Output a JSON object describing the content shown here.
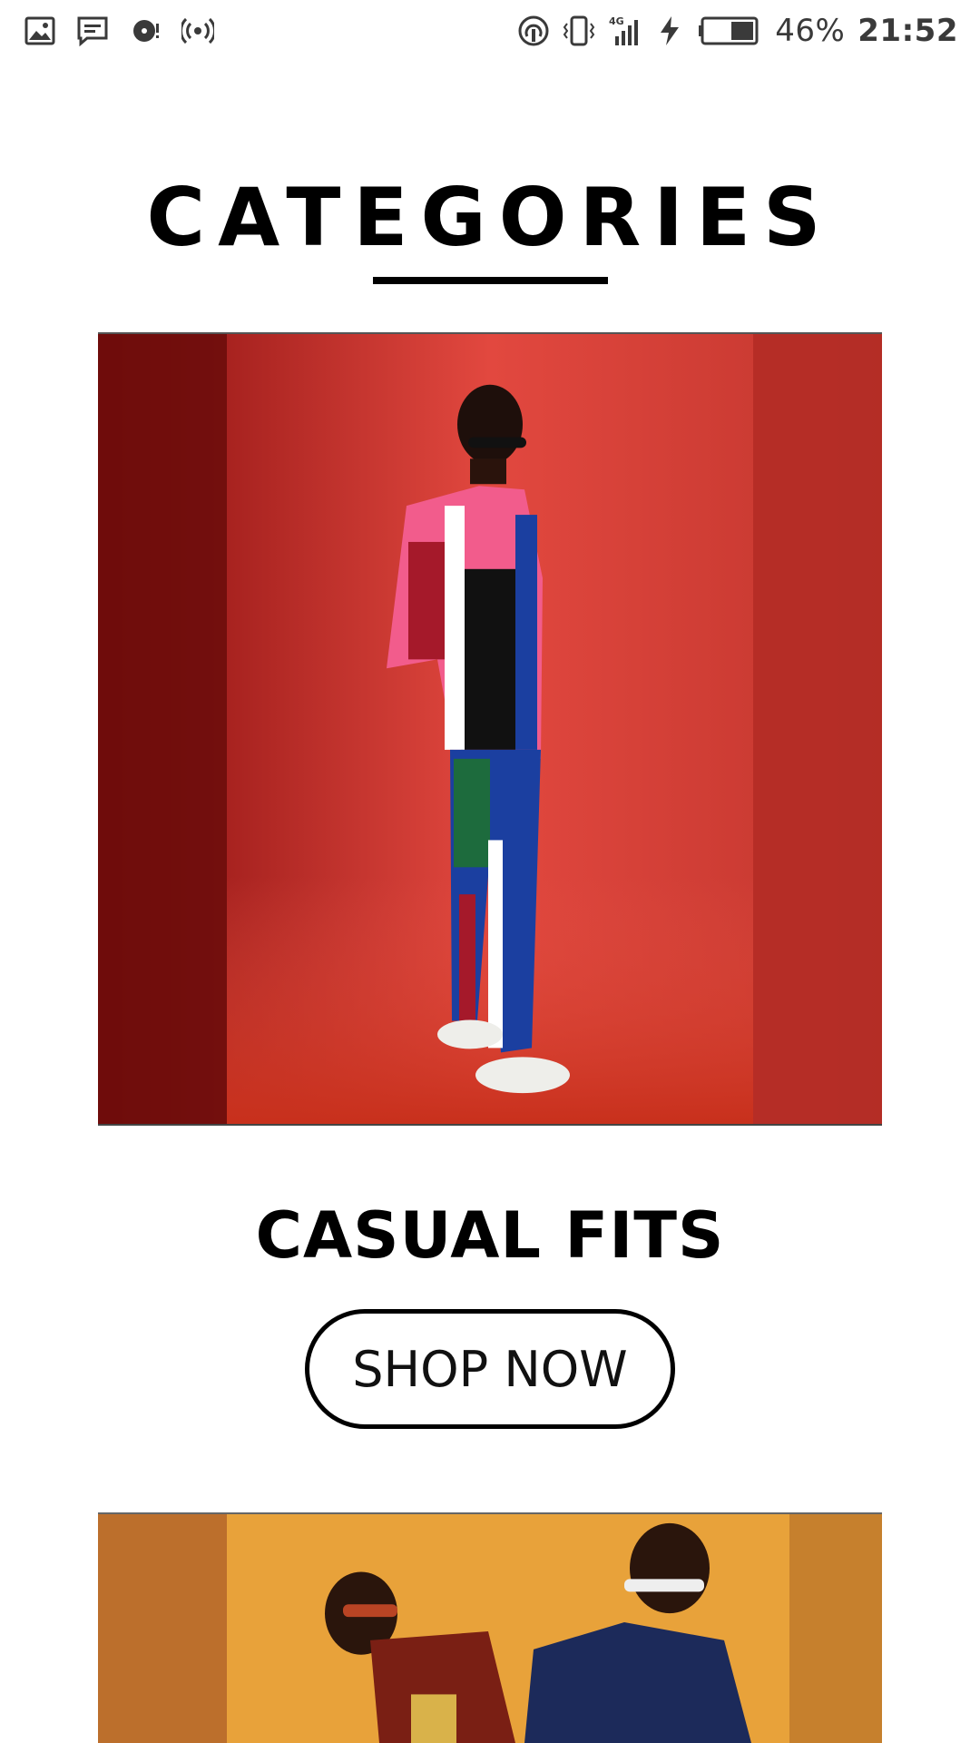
{
  "status_bar": {
    "left_icons": [
      "image-icon",
      "message-icon",
      "music-icon",
      "hotspot-icon"
    ],
    "right_icons": [
      "nfc-icon",
      "vibrate-icon",
      "signal-4g-icon",
      "charging-icon",
      "battery-icon"
    ],
    "battery_percent": "46%",
    "time": "21:52"
  },
  "page": {
    "title": "CATEGORIES"
  },
  "categories": [
    {
      "title": "CASUAL FITS",
      "button_label": "SHOP NOW",
      "image": "casual-fits-photo"
    },
    {
      "image": "second-category-photo"
    }
  ],
  "colors": {
    "accent": "#000000",
    "card1_background": "#d8392f",
    "card2_background": "#e8a23a"
  }
}
